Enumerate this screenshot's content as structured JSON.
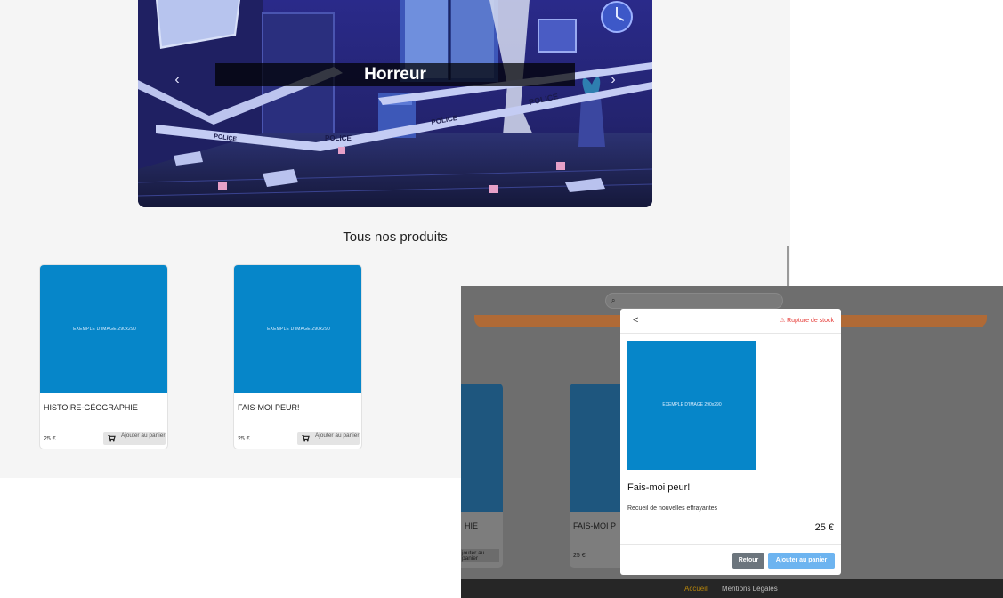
{
  "carousel": {
    "caption": "Horreur",
    "prev_icon": "‹",
    "next_icon": "›",
    "scene_text": "POLICE"
  },
  "products_section": {
    "title": "Tous nos produits",
    "image_placeholder": "EXEMPLE D'IMAGE 290x290",
    "add_label": "Ajouter au panier",
    "items": [
      {
        "name": "HISTOIRE-GÉOGRAPHIE",
        "price": "25 €"
      },
      {
        "name": "FAIS-MOI PEUR!",
        "price": "25 €"
      }
    ]
  },
  "overlay": {
    "search_icon": "⌕",
    "cards": [
      {
        "name": "HIE",
        "price": "",
        "button": "jouter au\npanier"
      },
      {
        "name": "FAIS-MOI P",
        "price": "25 €",
        "button": ""
      }
    ],
    "footer": {
      "home": "Accueil",
      "legal": "Mentions Légales"
    },
    "modal": {
      "back": "<",
      "stock_status": "⚠ Rupture de stock",
      "image_placeholder": "EXEMPLE D'IMAGE 290x290",
      "title": "Fais-moi peur!",
      "description": "Recueil de nouvelles effrayantes",
      "price": "25 €",
      "retour": "Retour",
      "add": "Ajouter au panier"
    }
  },
  "colors": {
    "card_image": "#0686c9",
    "accent": "#6db4f0",
    "danger": "#e53935"
  }
}
